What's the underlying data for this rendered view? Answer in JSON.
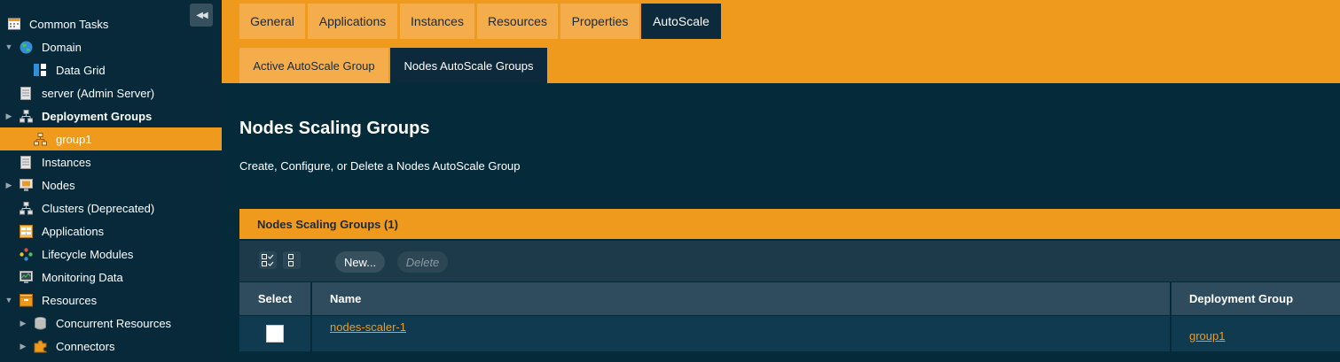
{
  "sidebar": {
    "collapse_label": "◀◀",
    "items": [
      {
        "label": "Common Tasks",
        "icon": "calendar-icon",
        "bold": false
      },
      {
        "label": "Domain",
        "icon": "globe-icon",
        "bold": false
      },
      {
        "label": "Data Grid",
        "icon": "data-grid-icon",
        "bold": false
      },
      {
        "label": "server (Admin Server)",
        "icon": "server-icon",
        "bold": false
      },
      {
        "label": "Deployment Groups",
        "icon": "hierarchy-icon",
        "bold": true
      },
      {
        "label": "group1",
        "icon": "hierarchy-icon",
        "bold": false,
        "selected": true
      },
      {
        "label": "Instances",
        "icon": "server-icon",
        "bold": false
      },
      {
        "label": "Nodes",
        "icon": "monitor-node-icon",
        "bold": false
      },
      {
        "label": "Clusters (Deprecated)",
        "icon": "hierarchy-icon",
        "bold": false
      },
      {
        "label": "Applications",
        "icon": "applications-icon",
        "bold": false
      },
      {
        "label": "Lifecycle Modules",
        "icon": "lifecycle-icon",
        "bold": false
      },
      {
        "label": "Monitoring Data",
        "icon": "monitor-icon",
        "bold": false
      },
      {
        "label": "Resources",
        "icon": "resources-box-icon",
        "bold": false
      },
      {
        "label": "Concurrent Resources",
        "icon": "database-icon",
        "bold": false
      },
      {
        "label": "Connectors",
        "icon": "puzzle-icon",
        "bold": false
      }
    ]
  },
  "tabs": {
    "top": [
      "General",
      "Applications",
      "Instances",
      "Resources",
      "Properties",
      "AutoScale"
    ],
    "active_top": "AutoScale",
    "sub": [
      "Active AutoScale Group",
      "Nodes AutoScale Groups"
    ],
    "active_sub": "Nodes AutoScale Groups"
  },
  "main": {
    "title": "Nodes Scaling Groups",
    "description": "Create, Configure, or Delete a Nodes AutoScale Group",
    "table": {
      "title": "Nodes Scaling Groups (1)",
      "new_button": "New...",
      "delete_button": "Delete",
      "columns": [
        "Select",
        "Name",
        "Deployment Group"
      ],
      "rows": [
        {
          "name": "nodes-scaler-1",
          "deployment_group": "group1",
          "selected": false
        }
      ]
    }
  },
  "colors": {
    "accent": "#f09a1d",
    "sidebar_bg": "#07293a",
    "main_bg": "#052a3a",
    "tab_active": "#0c2a3b"
  }
}
